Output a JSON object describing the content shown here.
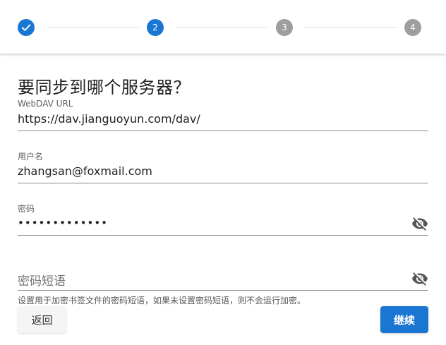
{
  "stepper": {
    "steps": [
      {
        "label": "",
        "state": "completed"
      },
      {
        "label": "2",
        "state": "active"
      },
      {
        "label": "3",
        "state": "inactive"
      },
      {
        "label": "4",
        "state": "inactive"
      }
    ]
  },
  "title": "要同步到哪个服务器？",
  "fields": {
    "url": {
      "label": "WebDAV URL",
      "value": "https://dav.jianguoyun.com/dav/"
    },
    "username": {
      "label": "用户名",
      "value": "zhangsan@foxmail.com"
    },
    "password": {
      "label": "密码",
      "value": "•••••••••••••"
    },
    "passphrase": {
      "placeholder": "密码短语"
    }
  },
  "hint": "设置用于加密书签文件的密码短语，如果未设置密码短语，则不会运行加密。",
  "buttons": {
    "back": "返回",
    "continue": "继续"
  },
  "colors": {
    "accent": "#1976d2",
    "inactive_step": "#9e9e9e"
  }
}
